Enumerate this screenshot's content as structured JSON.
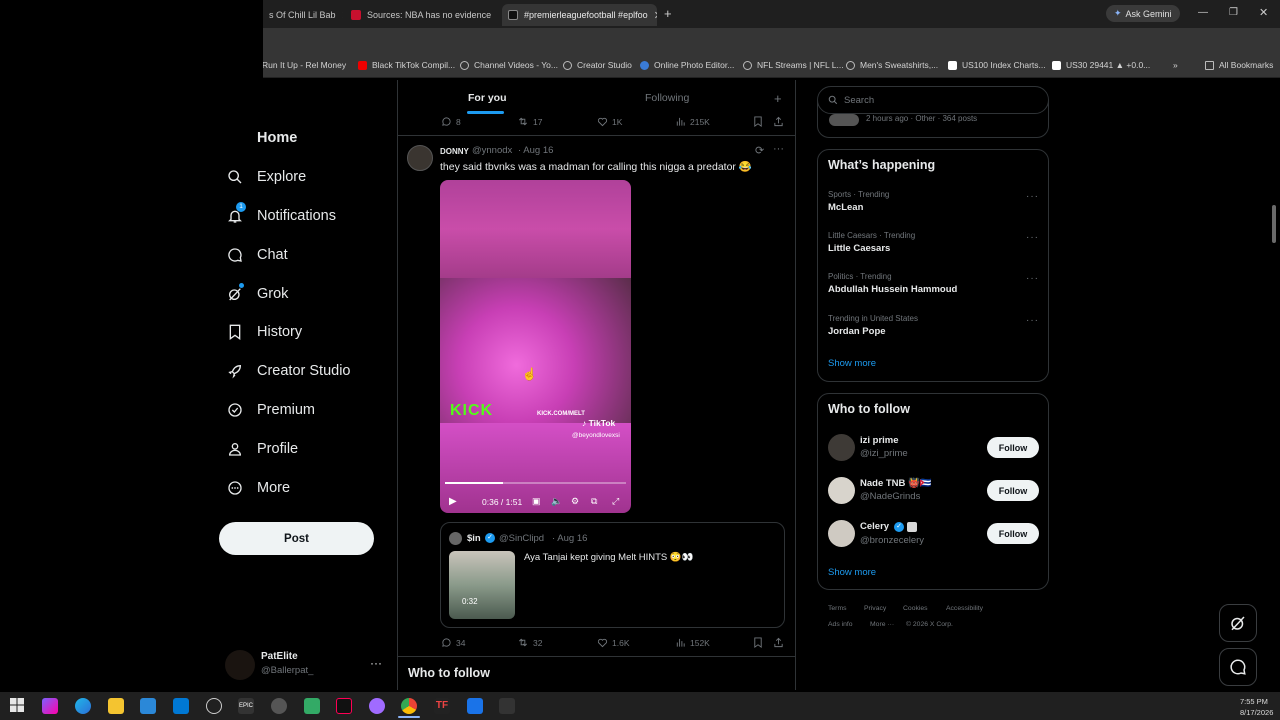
{
  "browser": {
    "tabs": [
      {
        "title": "s Of Chill Lil Bab"
      },
      {
        "title": "Sources: NBA has no evidence"
      },
      {
        "title": "#premierleaguefootball #eplfoo"
      }
    ],
    "ask_gemini": "Ask Gemini",
    "bookmarks": [
      "Run It Up - Rel Money",
      "Black TikTok Compil...",
      "Channel Videos - Yo...",
      "Creator Studio",
      "Online Photo Editor...",
      "NFL Streams | NFL L...",
      "Men's Sweatshirts,...",
      "US100 Index Charts...",
      "US30 29441 ▲ +0.0..."
    ],
    "all_bookmarks": "All Bookmarks"
  },
  "nav": {
    "items": [
      {
        "label": "Home",
        "icon": "home-icon"
      },
      {
        "label": "Explore",
        "icon": "search-icon"
      },
      {
        "label": "Notifications",
        "icon": "bell-icon"
      },
      {
        "label": "Chat",
        "icon": "chat-icon"
      },
      {
        "label": "Grok",
        "icon": "grok-icon"
      },
      {
        "label": "History",
        "icon": "bookmark-icon"
      },
      {
        "label": "Creator Studio",
        "icon": "rocket-icon"
      },
      {
        "label": "Premium",
        "icon": "verified-icon"
      },
      {
        "label": "Profile",
        "icon": "person-icon"
      },
      {
        "label": "More",
        "icon": "more-circle-icon"
      }
    ],
    "notification_badge": "1",
    "post_label": "Post",
    "account": {
      "name": "PatElite",
      "handle": "@Ballerpat_"
    }
  },
  "feed": {
    "tabs": [
      "For you",
      "Following"
    ],
    "prev_actions": {
      "replies": "8",
      "reposts": "17",
      "likes": "1K",
      "views": "215K"
    },
    "tweet": {
      "name": "DONNY",
      "handle": "@ynnodx",
      "date": "· Aug 16",
      "text": "they said tbvnks was a madman for calling this nigga a predator 😂",
      "video": {
        "time": "0:36 / 1:51",
        "overlay_kick": "KICK",
        "overlay_url": "KICK.COM/MELT",
        "overlay_tiktok": "TikTok",
        "overlay_tiktok_handle": "@beyondlovexsi",
        "progress": 0.32
      },
      "quote": {
        "name": "$in",
        "handle": "@SinClipd",
        "date": "· Aug 16",
        "text": "Aya Tanjai kept giving Melt HINTS 😳👀",
        "duration": "0:32"
      },
      "actions": {
        "replies": "34",
        "reposts": "32",
        "likes": "1.6K",
        "views": "152K"
      }
    },
    "who_to_follow_heading": "Who to follow"
  },
  "sidebar": {
    "search_placeholder": "Search",
    "top_meta": "2 hours ago · Other · 364 posts",
    "happening_title": "What’s happening",
    "trends": [
      {
        "meta": "Sports · Trending",
        "name": "McLean"
      },
      {
        "meta": "Little Caesars · Trending",
        "name": "Little Caesars"
      },
      {
        "meta": "Politics · Trending",
        "name": "Abdullah Hussein Hammoud"
      },
      {
        "meta": "Trending in United States",
        "name": "Jordan Pope"
      }
    ],
    "show_more": "Show more",
    "follow_title": "Who to follow",
    "follow": [
      {
        "name": "izi prime",
        "handle": "@izi_prime"
      },
      {
        "name": "Nade TNB 👹🇨🇺",
        "handle": "@NadeGrinds"
      },
      {
        "name": "Celery",
        "handle": "@bronzecelery"
      }
    ],
    "follow_label": "Follow",
    "footer": {
      "terms": "Terms",
      "privacy": "Privacy",
      "cookies": "Cookies",
      "accessibility": "Accessibility",
      "ads": "Ads info",
      "more": "More ···",
      "copyright": "© 2026 X Corp."
    }
  },
  "taskbar": {
    "time": "7:55 PM",
    "date": "8/17/2026"
  },
  "colors": {
    "accent": "#1d9bf0",
    "bg": "#000000",
    "border": "#2f3336",
    "muted": "#71767b"
  }
}
